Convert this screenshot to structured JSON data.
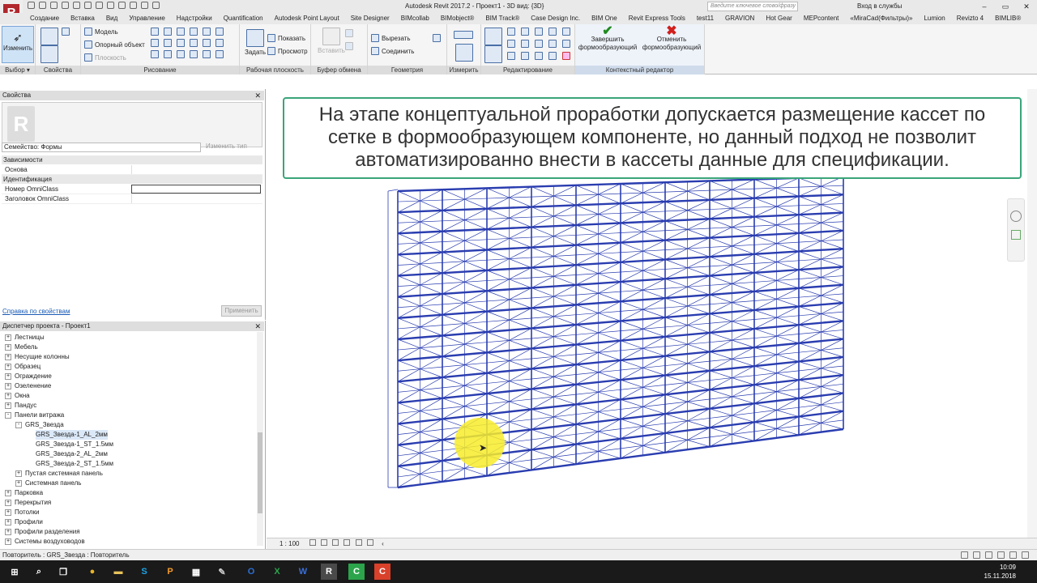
{
  "titlebar": {
    "app_title": "Autodesk Revit 2017.2  -    Проект1 - 3D вид: {3D}",
    "search_placeholder": "Введите ключевое слово/фразу",
    "signin_label": "Вход в службы"
  },
  "menu": {
    "items": [
      "Создание",
      "Вставка",
      "Вид",
      "Управление",
      "Надстройки",
      "Quantification",
      "Autodesk Point Layout",
      "Site Designer",
      "BIMcollab",
      "BIMobject®",
      "BIM Track®",
      "Case Design Inc.",
      "BIM One",
      "Revit Express Tools",
      "test11",
      "GRAVION",
      "Hot Gear",
      "MEPcontent",
      "«MiraCad(Фильтры)»",
      "Lumion",
      "Revizto 4",
      "BIMLIB®"
    ]
  },
  "ribbon": {
    "select": {
      "modify_label": "Изменить",
      "panel_label": "Выбор ▾"
    },
    "properties": {
      "panel_label": "Свойства"
    },
    "draw": {
      "model": "Модель",
      "ref": "Опорный объект",
      "plane": "Плоскость",
      "panel_label": "Рисование"
    },
    "workplane": {
      "set": "Задать",
      "show": "Показать",
      "viewer": "Просмотр",
      "panel_label": "Рабочая плоскость"
    },
    "clipboard": {
      "paste": "Вставить",
      "panel_label": "Буфер обмена"
    },
    "geometry": {
      "cut": "Вырезать",
      "join": "Соединить",
      "panel_label": "Геометрия"
    },
    "measure": {
      "panel_label": "Измерить"
    },
    "modify": {
      "panel_label": "Редактирование"
    },
    "incontext": {
      "finish": "Завершить формообразующий",
      "cancel": "Отменить формообразующий",
      "panel_label": "Контекстный редактор"
    }
  },
  "properties": {
    "header": "Свойства",
    "family_select": "Семейство: Формы",
    "edit_type": "Изменить тип",
    "groups": [
      {
        "label": "Зависимости",
        "rows": [
          {
            "name": "Основа",
            "value": ""
          }
        ]
      },
      {
        "label": "Идентификация",
        "rows": [
          {
            "name": "Номер OmniClass",
            "value": ""
          },
          {
            "name": "Заголовок OmniClass",
            "value": ""
          }
        ]
      }
    ],
    "help_link": "Справка по свойствам",
    "apply_button": "Применить"
  },
  "browser": {
    "header": "Диспетчер проекта - Проект1",
    "items": [
      {
        "label": "Лестницы",
        "level": 1,
        "toggle": "+"
      },
      {
        "label": "Мебель",
        "level": 1,
        "toggle": "+"
      },
      {
        "label": "Несущие колонны",
        "level": 1,
        "toggle": "+"
      },
      {
        "label": "Образец",
        "level": 1,
        "toggle": "+"
      },
      {
        "label": "Ограждение",
        "level": 1,
        "toggle": "+"
      },
      {
        "label": "Озеленение",
        "level": 1,
        "toggle": "+"
      },
      {
        "label": "Окна",
        "level": 1,
        "toggle": "+"
      },
      {
        "label": "Пандус",
        "level": 1,
        "toggle": "+"
      },
      {
        "label": "Панели витража",
        "level": 1,
        "toggle": "-"
      },
      {
        "label": "GRS_Звезда",
        "level": 2,
        "toggle": "-"
      },
      {
        "label": "GRS_Звезда-1_AL_2мм",
        "level": 3,
        "toggle": "",
        "selected": true
      },
      {
        "label": "GRS_Звезда-1_ST_1.5мм",
        "level": 3,
        "toggle": ""
      },
      {
        "label": "GRS_Звезда-2_AL_2мм",
        "level": 3,
        "toggle": ""
      },
      {
        "label": "GRS_Звезда-2_ST_1.5мм",
        "level": 3,
        "toggle": ""
      },
      {
        "label": "Пустая системная панель",
        "level": 2,
        "toggle": "+"
      },
      {
        "label": "Системная панель",
        "level": 2,
        "toggle": "+"
      },
      {
        "label": "Парковка",
        "level": 1,
        "toggle": "+"
      },
      {
        "label": "Перекрытия",
        "level": 1,
        "toggle": "+"
      },
      {
        "label": "Потолки",
        "level": 1,
        "toggle": "+"
      },
      {
        "label": "Профили",
        "level": 1,
        "toggle": "+"
      },
      {
        "label": "Профили разделения",
        "level": 1,
        "toggle": "+"
      },
      {
        "label": "Системы воздуховодов",
        "level": 1,
        "toggle": "+"
      }
    ]
  },
  "viewport": {
    "callout_line1": "На этапе концептуальной проработки допускается размещение кассет по",
    "callout_line2": "сетке в формообразующем компоненте, но данный подход не позволит",
    "callout_line3": "автоматизированно внести в кассеты данные для спецификации.",
    "scale": "1 : 100",
    "panel_color": "#2a3db0",
    "highlight_color": "#f8ec2a"
  },
  "status": {
    "text": "Повторитель : GRS_Звезда : Повторитель"
  },
  "taskbar": {
    "time": "10:09",
    "date": "15.11.2018"
  }
}
